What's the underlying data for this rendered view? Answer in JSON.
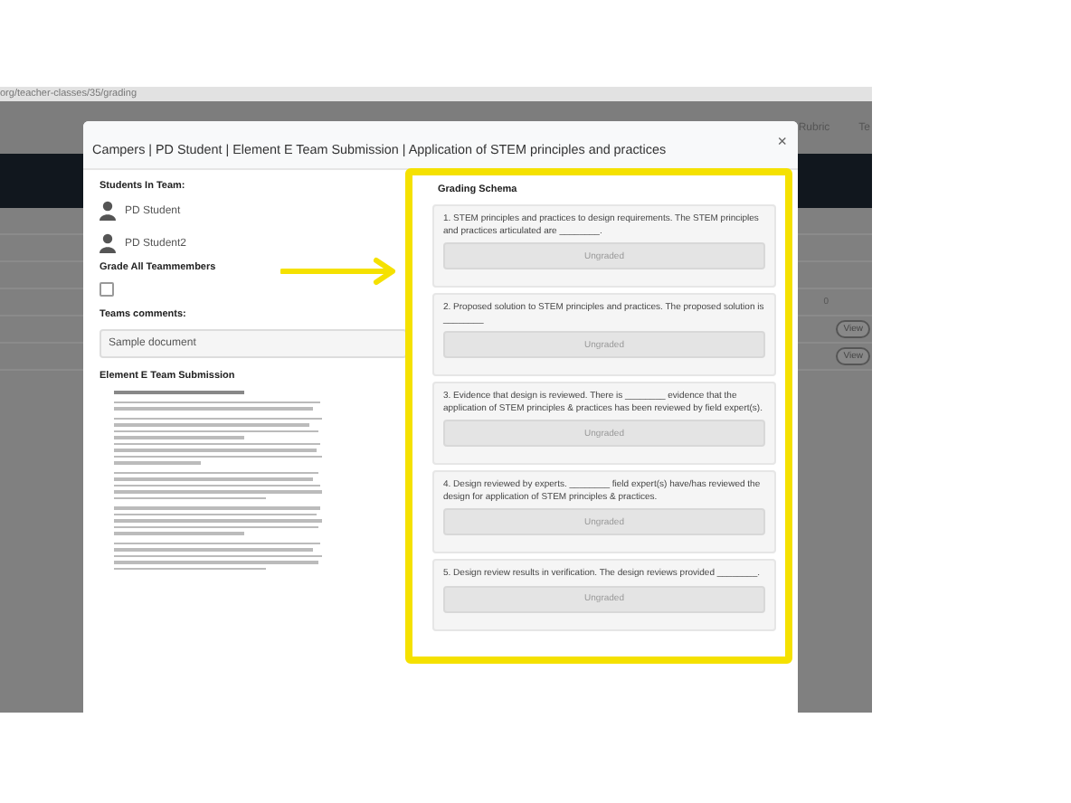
{
  "browser": {
    "url": "org/teacher-classes/35/grading"
  },
  "background_page": {
    "nav_items": [
      "Rubric",
      "Te"
    ],
    "cell": "0",
    "buttons": [
      "View",
      "View"
    ]
  },
  "modal": {
    "title": "Campers | PD Student | Element E Team Submission | Application of STEM principles and practices",
    "close": "×",
    "students_heading": "Students In Team:",
    "students": [
      "PD Student",
      "PD Student2"
    ],
    "grade_all": {
      "label": "Grade All Teammembers",
      "checked": false
    },
    "comments_label": "Teams comments:",
    "comments_value": "Sample document",
    "submission_heading": "Element E Team Submission",
    "grading": {
      "heading": "Grading Schema",
      "criteria": [
        {
          "text": "1. STEM principles and practices to design requirements. The STEM principles and practices articulated are ________.",
          "grade": "Ungraded"
        },
        {
          "text": "2. Proposed solution to STEM principles and practices. The proposed solution is ________",
          "grade": "Ungraded"
        },
        {
          "text": "3. Evidence that design is reviewed. There is ________ evidence that the application of STEM principles & practices has been reviewed by field expert(s).",
          "grade": "Ungraded"
        },
        {
          "text": "4. Design reviewed by experts. ________ field expert(s) have/has reviewed the design for application of STEM principles & practices.",
          "grade": "Ungraded"
        },
        {
          "text": "5. Design review results in verification. The design reviews provided ________.",
          "grade": "Ungraded"
        }
      ]
    }
  }
}
